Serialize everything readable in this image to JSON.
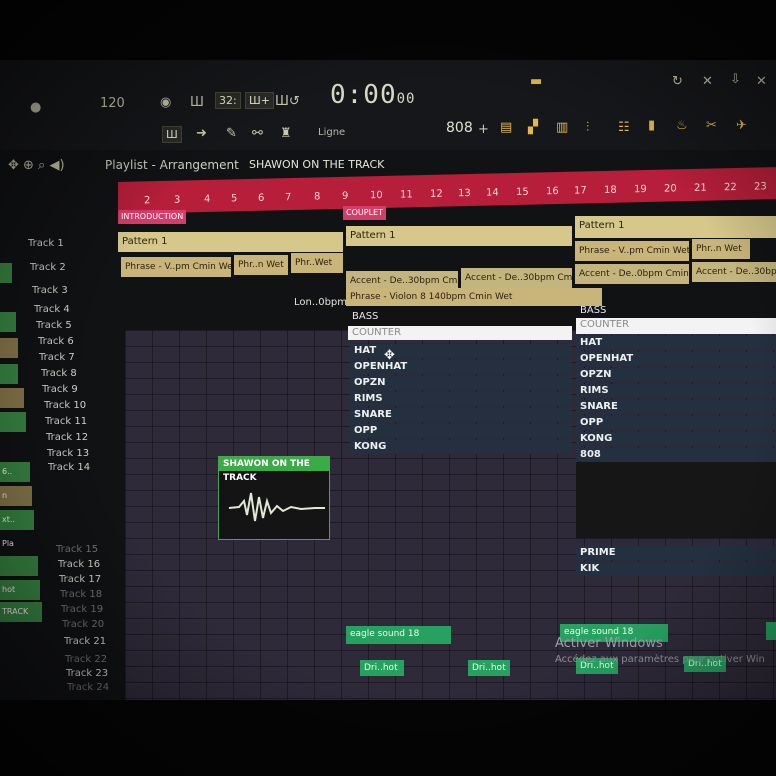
{
  "toolbar": {
    "time": "0:00",
    "time_sub": "00",
    "tempo_display": "120",
    "snap_label": "Ligne",
    "pattern_number": "808",
    "buttons": [
      "32:",
      "Ш+",
      "Ш"
    ]
  },
  "playlist": {
    "title": "Playlist - Arrangement",
    "song": "SHAWON ON THE TRACK"
  },
  "ruler": {
    "numbers": [
      "2",
      "3",
      "4",
      "5",
      "6",
      "7",
      "8",
      "9",
      "10",
      "11",
      "12",
      "13",
      "14",
      "15",
      "16",
      "17",
      "18",
      "19",
      "20",
      "21",
      "22",
      "23"
    ],
    "markers": [
      "INTRODUCTION",
      "COUPLET"
    ]
  },
  "tracks": [
    "Track 1",
    "Track 2",
    "Track 3",
    "Track 4",
    "Track 5",
    "Track 6",
    "Track 7",
    "Track 8",
    "Track 9",
    "Track 10",
    "Track 11",
    "Track 12",
    "Track 13",
    "Track 14",
    "Track 15",
    "Track 16",
    "Track 17",
    "Track 18",
    "Track 19",
    "Track 20",
    "Track 21",
    "Track 22",
    "Track 23",
    "Track 24"
  ],
  "clips": {
    "pattern1": "Pattern 1",
    "phrase_v": "Phrase - V..pm Cmin Wet",
    "phr_n": "Phr..n Wet",
    "phr_wet": "Phr..Wet",
    "accent1": "Accent - De..30bpm Cmin",
    "accent2": "Accent - De..30bpm Cmin",
    "accent3": "Accent - De..0bpm Cmin",
    "accent4": "Accent - De..30bp",
    "lon": "Lon..0bpm",
    "violon": "Phrase - Violon 8 140bpm Cmin Wet",
    "bass": "BASS",
    "counter": "COUNTER",
    "drums": [
      "HAT",
      "OPENHAT",
      "OPZN",
      "RIMS",
      "SNARE",
      "OPP",
      "KONG"
    ],
    "drums_right": [
      "HAT",
      "OPENHAT",
      "OPZN",
      "RIMS",
      "SNARE",
      "OPP",
      "KONG",
      "808"
    ],
    "prime": "PRIME",
    "kik": "KIK",
    "audio_title": "SHAWON ON THE TRACK",
    "eagle": "eagle sound 18",
    "dri": "Dri..hot"
  },
  "side_labels": [
    "6..",
    "n",
    "xt..",
    "Pla",
    "hot",
    "TRACK"
  ],
  "watermark": {
    "title": "Activer Windows",
    "subtitle": "Accédez aux paramètres pour activer Win"
  }
}
